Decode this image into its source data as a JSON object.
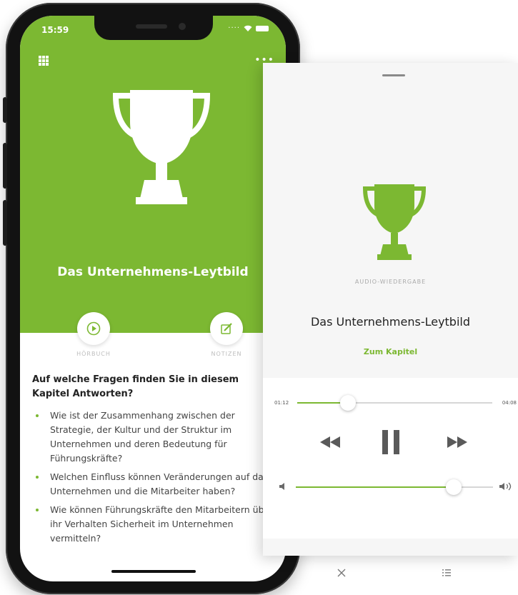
{
  "status": {
    "time": "15:59"
  },
  "screen": {
    "title": "Das Unternehmens-Leytbild",
    "audio_label": "HÖRBUCH",
    "notes_label": "NOTIZEN",
    "question": "Auf welche Fragen finden Sie in diesem Kapitel Antworten?",
    "bullets": [
      "Wie ist der Zusammenhang zwischen der Strategie, der Kultur und der Struktur im Unternehmen und deren Bedeutung für Führungskräfte?",
      "Welchen Einfluss können Veränderungen auf das Unternehmen und die Mitarbeiter haben?",
      "Wie können Führungskräfte den Mitarbeitern über ihr Verhalten Sicherheit im Unternehmen vermitteln?"
    ]
  },
  "player": {
    "caption": "AUDIO-WIEDERGABE",
    "title": "Das Unternehmens-Leytbild",
    "chapter_link": "Zum Kapitel",
    "current_time": "01:12",
    "total_time": "04:08",
    "progress": 0.26,
    "volume": 0.8
  },
  "colors": {
    "accent": "#7cb832"
  },
  "icons": [
    "grid-icon",
    "more-icon",
    "trophy-icon",
    "play-icon",
    "edit-icon",
    "rewind-icon",
    "pause-icon",
    "forward-icon",
    "volume-low-icon",
    "volume-high-icon",
    "close-icon",
    "list-icon"
  ]
}
